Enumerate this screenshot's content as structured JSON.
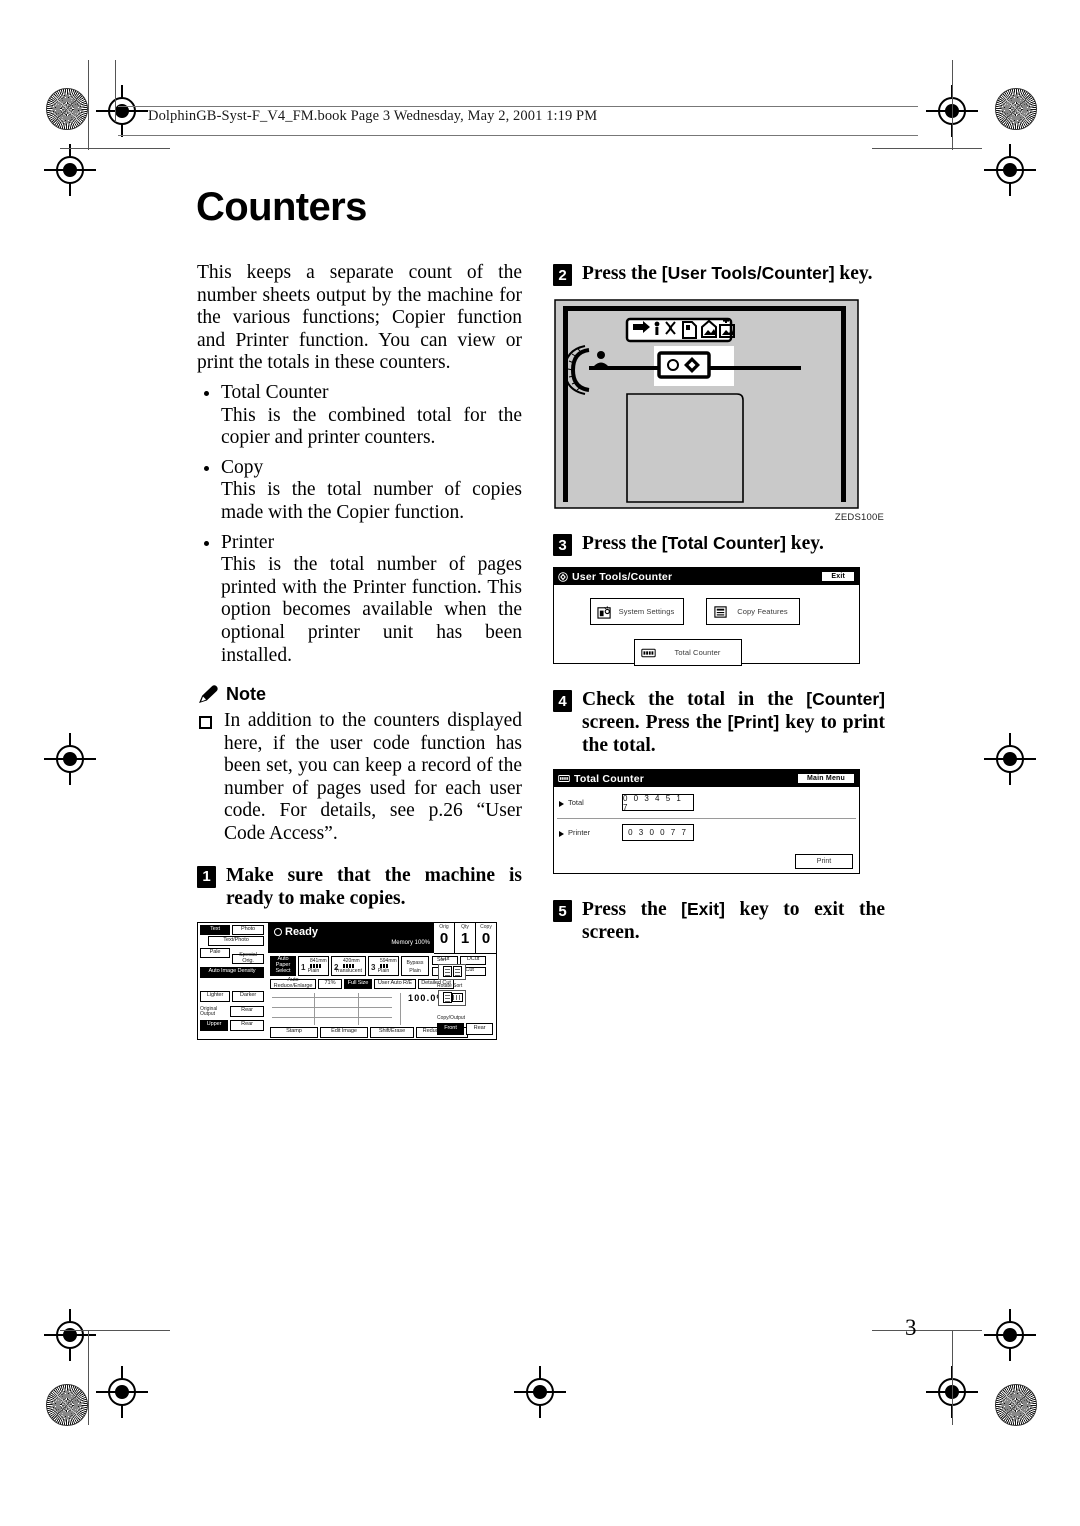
{
  "file_header": "DolphinGB-Syst-F_V4_FM.book  Page 3  Wednesday, May 2, 2001  1:19 PM",
  "page_number": "3",
  "title": "Counters",
  "intro": "This keeps a separate count of the number sheets output by the machine for the various functions; Copier function and Printer function. You can view or print the totals in these counters.",
  "bullets": [
    {
      "term": "Total Counter",
      "desc": "This is the combined total for the copier and printer counters."
    },
    {
      "term": "Copy",
      "desc": "This is the total number of copies made with the Copier function."
    },
    {
      "term": "Printer",
      "desc": "This is the total number of pages printed with the Printer function. This option becomes available when the optional printer unit has been installed."
    }
  ],
  "note": {
    "label": "Note",
    "icon": "pencil-icon",
    "items": [
      "In addition to the counters displayed here, if the user code function has been set, you can keep a record of the number of pages used for each user code. For details, see p.26 “User Code Access”."
    ]
  },
  "steps": [
    {
      "num": "1",
      "parts": [
        {
          "t": "Make sure that the machine is ready to make copies.",
          "k": false
        }
      ]
    },
    {
      "num": "2",
      "parts": [
        {
          "t": "Press the ",
          "k": false
        },
        {
          "t": "[User Tools/Counter]",
          "k": true
        },
        {
          "t": " key.",
          "k": false
        }
      ]
    },
    {
      "num": "3",
      "parts": [
        {
          "t": "Press the ",
          "k": false
        },
        {
          "t": "[Total Counter]",
          "k": true
        },
        {
          "t": " key.",
          "k": false
        }
      ]
    },
    {
      "num": "4",
      "parts": [
        {
          "t": "Check the total in the ",
          "k": false
        },
        {
          "t": "[Counter]",
          "k": true
        },
        {
          "t": " screen. Press the ",
          "k": false
        },
        {
          "t": "[Print]",
          "k": true
        },
        {
          "t": " key to print the total.",
          "k": false
        }
      ]
    },
    {
      "num": "5",
      "parts": [
        {
          "t": "Press the ",
          "k": false
        },
        {
          "t": "[Exit]",
          "k": true
        },
        {
          "t": " key to exit the screen.",
          "k": false
        }
      ]
    }
  ],
  "illustration": {
    "code": "ZEDS100E",
    "description": "control-panel-illustration"
  },
  "user_tools_screen": {
    "title": "User Tools/Counter",
    "exit_label": "Exit",
    "buttons": [
      {
        "label": "System Settings",
        "icon": "system-settings-icon"
      },
      {
        "label": "Copy Features",
        "icon": "copy-features-icon"
      },
      {
        "label": "Total Counter",
        "icon": "total-counter-icon"
      }
    ]
  },
  "total_counter_screen": {
    "title": "Total Counter",
    "main_menu_label": "Main Menu",
    "rows": [
      {
        "label": "Total",
        "value": "0 0 3 4 5 1 7"
      },
      {
        "label": "Printer",
        "value": "0 3 0 0 7 7"
      }
    ],
    "print_label": "Print"
  },
  "copier_screen": {
    "status": "Ready",
    "memory": "Memory 100%",
    "zoom": "100.0%",
    "counters": [
      {
        "caption": "Orig",
        "value": "0"
      },
      {
        "caption": "Qty",
        "value": "1"
      },
      {
        "caption": "Copy",
        "value": "0"
      }
    ],
    "left_buttons": [
      "Text",
      "Photo",
      "Text/Photo",
      "Pale",
      "Special Orig.",
      "Auto Image Density",
      "Lighter",
      "Darker"
    ],
    "original_output": {
      "caption": "Original Output",
      "rows": [
        "Rear",
        "Rear"
      ],
      "upper": "Upper"
    },
    "paper_trays": [
      {
        "num": "1",
        "size": "841mm",
        "kind": "Plain"
      },
      {
        "num": "2",
        "size": "420mm",
        "kind": "Translucent"
      },
      {
        "num": "3",
        "size": "594mm",
        "kind": "Plain"
      }
    ],
    "bypass": {
      "label": "Bypass",
      "kind": "Plain"
    },
    "cut_buttons": [
      "Cut",
      "DCut",
      "Synchro Cut"
    ],
    "ratio_buttons": [
      "Auto Reduce/Enlarge",
      "71%",
      "Full Size",
      "User Auto R/E",
      "Detailed Cut"
    ],
    "bottom_buttons": [
      "Stamp",
      "Edit Image",
      "Shift/Erase",
      "Reduce/Enlarge"
    ],
    "sort": {
      "caption": "Sort"
    },
    "rotate_sort": {
      "caption": "Rotate Sort"
    },
    "copy_output": {
      "caption": "Copy/Output",
      "buttons": [
        "Front",
        "Rear"
      ]
    }
  },
  "colors": {
    "paper": "#ffffff",
    "ink": "#000000",
    "illustration_fill": "#c9c9c9",
    "rule": "#777777"
  }
}
